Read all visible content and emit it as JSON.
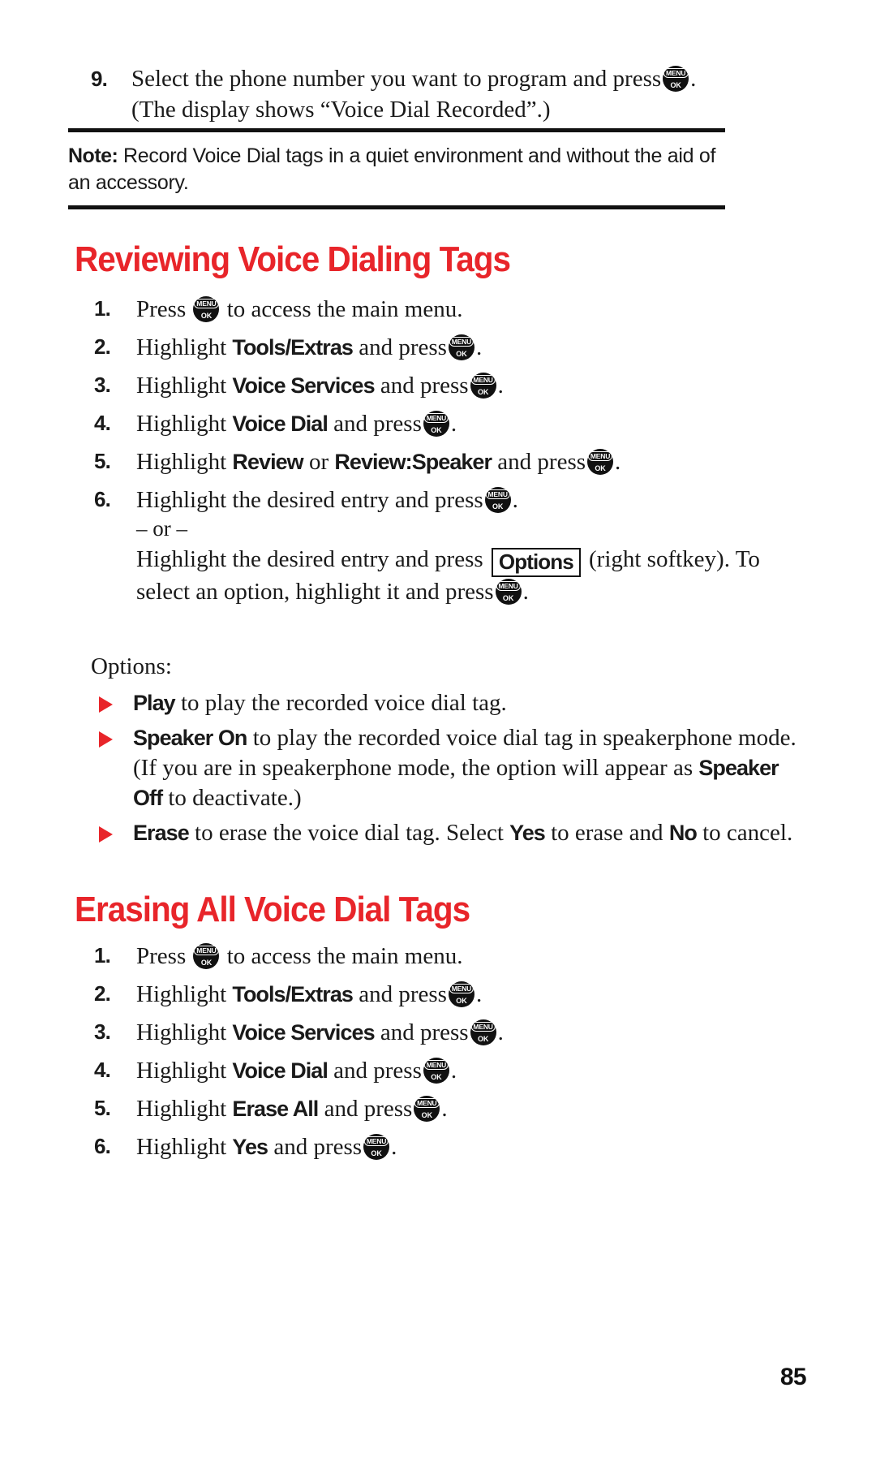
{
  "page": {
    "number": "85",
    "accent_color": "#E8252A",
    "text_color": "#1a1a1a",
    "background": "#ffffff"
  },
  "icons": {
    "menu_ok": {
      "line1": "MENU",
      "line2": "OK",
      "name": "menu-ok-key-icon"
    },
    "bullet": "red-triangle-bullet-icon"
  },
  "step9": {
    "number": "9.",
    "line1_a": "Select the phone number you want to program and press",
    "line1_b": ".",
    "line2": "(The display shows “Voice Dial Recorded”.)"
  },
  "note": {
    "label": "Note:",
    "body": " Record Voice Dial tags in a quiet environment and without the aid of an accessory."
  },
  "section1": {
    "heading": "Reviewing Voice Dialing Tags",
    "steps": [
      {
        "num": "1.",
        "pre": "Press",
        "term": "",
        "post": "to access the main menu."
      },
      {
        "num": "2.",
        "pre": "Highlight",
        "term": "Tools/Extras",
        "post": "and press"
      },
      {
        "num": "3.",
        "pre": "Highlight",
        "term": "Voice Services",
        "post": "and press"
      },
      {
        "num": "4.",
        "pre": "Highlight",
        "term": "Voice Dial",
        "post": "and press"
      },
      {
        "num": "5.",
        "pre": "Highlight",
        "term": "Review",
        "mid": "or",
        "term2": "Review:Speaker",
        "post": "and press"
      },
      {
        "num": "6.",
        "pre": "Highlight the desired entry and press",
        "post": "."
      }
    ],
    "step6_or": "– or –",
    "step6_alt_a": "Highlight the desired entry and press",
    "step6_softkey": "Options",
    "step6_alt_b": "(right softkey).",
    "step6_alt_c": "To select an option, highlight it and press",
    "options_label": "Options:",
    "options": [
      {
        "term": "Play",
        "text": " to play the recorded voice dial tag."
      },
      {
        "term": "Speaker On",
        "text_a": " to play the recorded voice dial tag in speakerphone mode. (If you are in speakerphone mode, the option will appear as ",
        "term2": "Speaker Off",
        "text_b": " to deactivate.)"
      },
      {
        "term": "Erase",
        "text_a": " to erase the voice dial tag. Select ",
        "term2": "Yes",
        "text_b": " to erase and ",
        "term3": "No",
        "text_c": " to cancel."
      }
    ]
  },
  "section2": {
    "heading": "Erasing All Voice Dial Tags",
    "steps": [
      {
        "num": "1.",
        "pre": "Press",
        "term": "",
        "post": "to access the main menu."
      },
      {
        "num": "2.",
        "pre": "Highlight",
        "term": "Tools/Extras",
        "post": "and press"
      },
      {
        "num": "3.",
        "pre": "Highlight",
        "term": "Voice Services",
        "post": "and press"
      },
      {
        "num": "4.",
        "pre": "Highlight",
        "term": "Voice Dial",
        "post": "and press"
      },
      {
        "num": "5.",
        "pre": "Highlight",
        "term": "Erase All",
        "post": "and press"
      },
      {
        "num": "6.",
        "pre": "Highlight",
        "term": "Yes",
        "post": "and press"
      }
    ]
  }
}
